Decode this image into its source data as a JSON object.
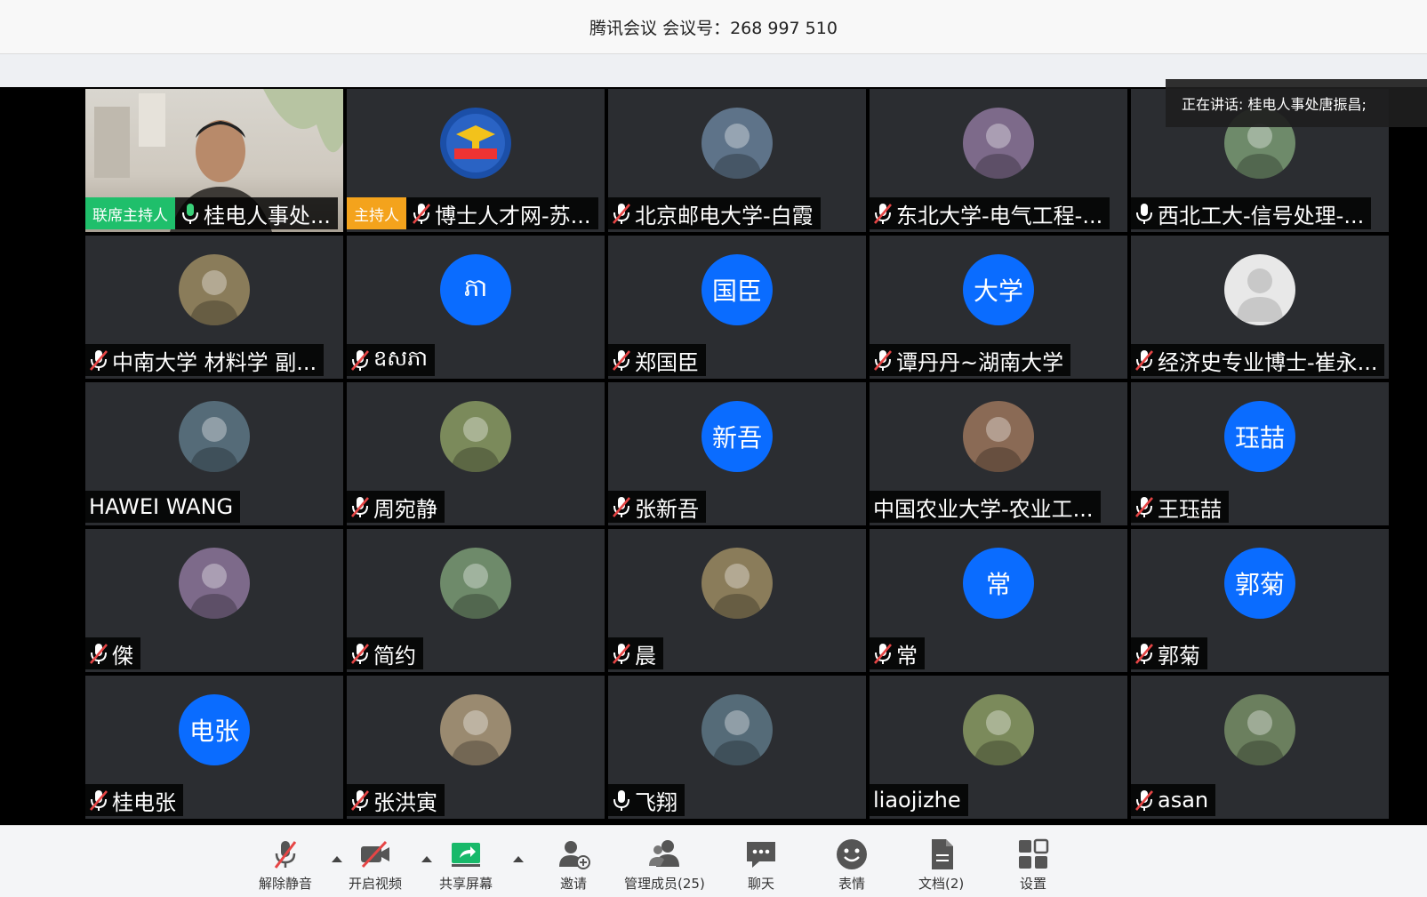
{
  "window": {
    "title": "腾讯会议 会议号：268 997 510"
  },
  "speaking_banner": "正在讲话: 桂电人事处唐振昌;",
  "colors": {
    "avatar_blue": "#0a6cff",
    "tile_bg": "#2b2d31",
    "cohost_badge": "#1fbf6b",
    "host_badge": "#f4a31c",
    "mute_red": "#e64545"
  },
  "participants": [
    {
      "name": "桂电人事处...",
      "role": "联席主持人",
      "mic": "on",
      "avatar": "video"
    },
    {
      "name": "博士人才网-苏...",
      "role": "主持人",
      "mic": "muted",
      "avatar": "logo"
    },
    {
      "name": "北京邮电大学-白霞",
      "mic": "muted",
      "avatar": "photo"
    },
    {
      "name": "东北大学-电气工程-...",
      "mic": "muted",
      "avatar": "photo"
    },
    {
      "name": "西北工大-信号处理-...",
      "mic": "on",
      "avatar": "photo"
    },
    {
      "name": "中南大学 材料学 副...",
      "mic": "muted",
      "avatar": "photo"
    },
    {
      "name": "ឧសភា",
      "mic": "muted",
      "avatar_text": "ភា"
    },
    {
      "name": "郑国臣",
      "mic": "muted",
      "avatar_text": "国臣"
    },
    {
      "name": "谭丹丹~湖南大学",
      "mic": "muted",
      "avatar_text": "大学"
    },
    {
      "name": "经济史专业博士-崔永...",
      "mic": "muted",
      "avatar": "default"
    },
    {
      "name": "HAWEI WANG",
      "mic": "none",
      "avatar": "photo"
    },
    {
      "name": "周宛静",
      "mic": "muted",
      "avatar": "photo"
    },
    {
      "name": "张新吾",
      "mic": "muted",
      "avatar_text": "新吾"
    },
    {
      "name": "中国农业大学-农业工...",
      "mic": "none",
      "avatar": "photo"
    },
    {
      "name": "王珏喆",
      "mic": "muted",
      "avatar_text": "珏喆"
    },
    {
      "name": "傑",
      "mic": "muted",
      "avatar": "photo"
    },
    {
      "name": "简约",
      "mic": "muted",
      "avatar": "photo"
    },
    {
      "name": "晨",
      "mic": "muted",
      "avatar": "photo"
    },
    {
      "name": "常",
      "mic": "muted",
      "avatar_text": "常"
    },
    {
      "name": "郭菊",
      "mic": "muted",
      "avatar_text": "郭菊"
    },
    {
      "name": "桂电张",
      "mic": "muted",
      "avatar_text": "电张"
    },
    {
      "name": "张洪寅",
      "mic": "muted",
      "avatar": "photo"
    },
    {
      "name": "飞翔",
      "mic": "on",
      "avatar": "photo"
    },
    {
      "name": "liaojizhe",
      "mic": "none",
      "avatar": "photo"
    },
    {
      "name": "asan",
      "mic": "muted",
      "avatar": "photo"
    }
  ],
  "toolbar": {
    "unmute": "解除静音",
    "start_video": "开启视频",
    "share_screen": "共享屏幕",
    "invite": "邀请",
    "manage_members": "管理成员(25)",
    "chat": "聊天",
    "reactions": "表情",
    "documents": "文档(2)",
    "settings": "设置"
  }
}
